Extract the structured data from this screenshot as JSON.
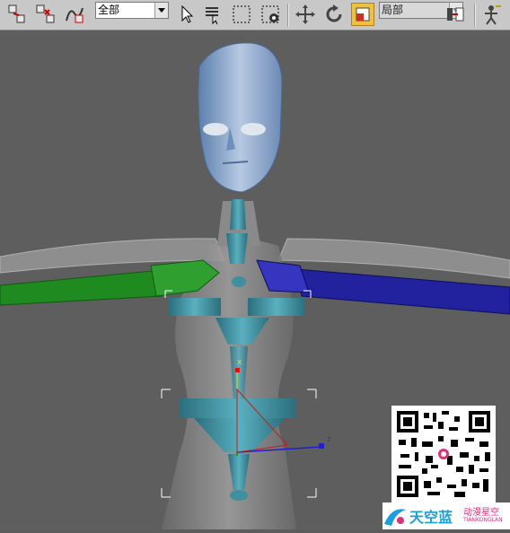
{
  "toolbar": {
    "selection_filter": "全部",
    "reference_coord": "局部",
    "icons": [
      "select-and-link-icon",
      "unlink-selection-icon",
      "bind-to-space-warp-icon",
      "select-object-icon",
      "select-by-name-icon",
      "rectangular-selection-region-icon",
      "window-crossing-icon",
      "select-and-move-icon",
      "select-and-rotate-icon",
      "select-and-scale-icon",
      "use-pivot-center-icon",
      "select-and-manipulate-icon"
    ]
  },
  "viewport": {
    "axis_x": "x",
    "axis_z": "z"
  },
  "watermark": {
    "brand_name": "天空蓝",
    "brand_tagline": "动漫星空",
    "brand_latin": "TIANKONGLAN"
  },
  "colors": {
    "toolbar_bg": "#c8c8c8",
    "viewport_bg": "#5e5e5e",
    "left_arm": "#1f8a1f",
    "right_arm": "#1e1ea8",
    "head": "#8fa8c8",
    "bones": "#3a8a9a"
  }
}
